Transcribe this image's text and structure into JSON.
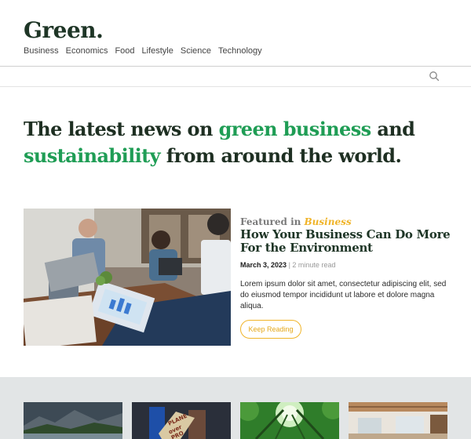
{
  "site": {
    "logo": "Green."
  },
  "nav": {
    "items": [
      "Business",
      "Economics",
      "Food",
      "Lifestyle",
      "Science",
      "Technology"
    ]
  },
  "header": {
    "search_icon": "search-icon"
  },
  "hero": {
    "line_a": "The latest news on ",
    "line_b": "green business",
    "line_c": " and ",
    "line_d": "sustainability",
    "line_e": " from around the world."
  },
  "featured": {
    "prefix": "Featured in ",
    "category": "Business",
    "title": "How Your Business Can Do More For the Environment",
    "date": "March 3, 2023",
    "separator": "|",
    "read_time": "2 minute read",
    "excerpt": "Lorem ipsum dolor sit amet, consectetur adipiscing elit, sed do eiusmod tempor incididunt ut labore et dolore magna aliqua.",
    "button_label": "Keep Reading"
  },
  "colors": {
    "accent_green": "#1f9d55",
    "accent_yellow": "#f0b429",
    "dark_green": "#1e3526"
  }
}
